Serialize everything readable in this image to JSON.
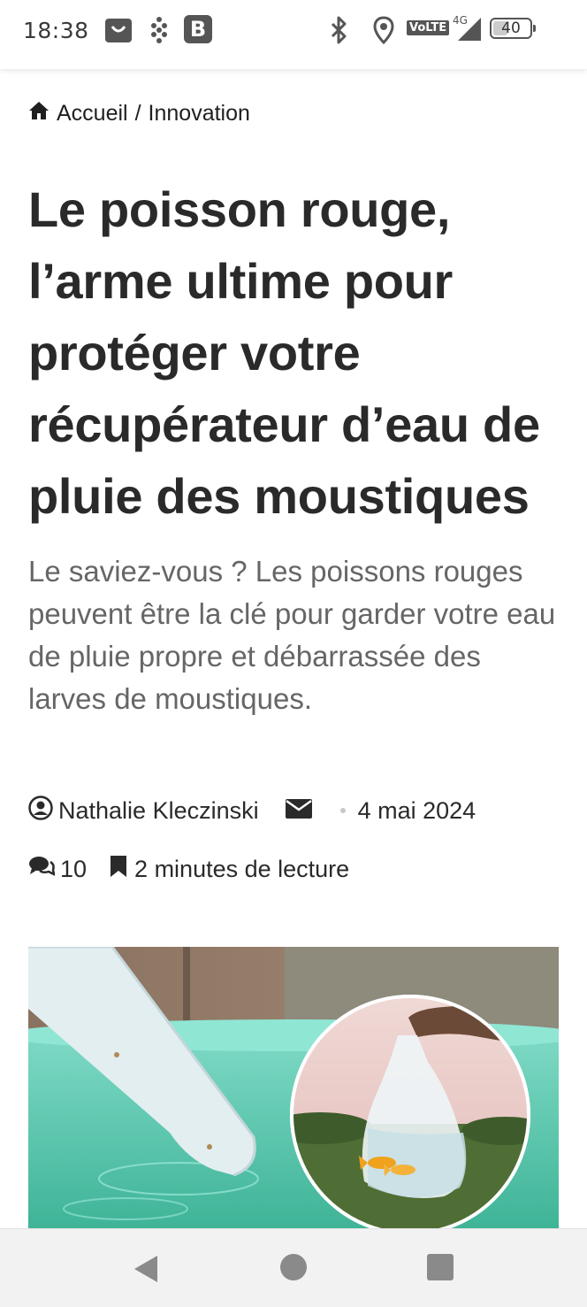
{
  "status_bar": {
    "time": "18:38",
    "network_badge": "VoLTE",
    "network_type": "4G",
    "battery_level": "40",
    "battery_fraction": 0.4,
    "icons": [
      "shopping-bag-icon",
      "grid-dots-icon",
      "b-app-icon",
      "bluetooth-icon",
      "location-icon",
      "volte-icon",
      "signal-icon",
      "battery-icon"
    ]
  },
  "breadcrumb": {
    "home_label": "Accueil",
    "separator": "/",
    "category": "Innovation"
  },
  "article": {
    "title": "Le poisson rouge, l’arme ultime pour protéger votre récupérateur d’eau de pluie des moustiques",
    "lead": "Le saviez-vous ? Les poissons rouges peuvent être la clé pour garder votre eau de pluie propre et débarrassée des larves de moustiques.",
    "author": "Nathalie Kleczinski",
    "date": "4 mai 2024",
    "comments_count": "10",
    "reading_time": "2 minutes de lecture"
  },
  "colors": {
    "title": "#2a2a2a",
    "lead": "#666666",
    "water": "#5fc9ad",
    "nav_bar": "#f2f2f2"
  }
}
